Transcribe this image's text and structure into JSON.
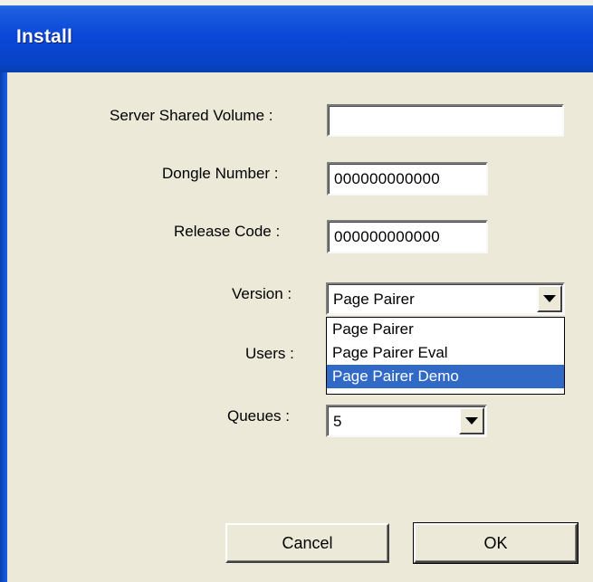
{
  "window": {
    "title": "Install"
  },
  "form": {
    "server_shared_volume": {
      "label": "Server Shared Volume :",
      "value": ""
    },
    "dongle_number": {
      "label": "Dongle Number :",
      "value": "000000000000"
    },
    "release_code": {
      "label": "Release Code :",
      "value": "000000000000"
    },
    "version": {
      "label": "Version :",
      "selected": "Page Pairer",
      "options": [
        "Page Pairer",
        "Page Pairer Eval",
        "Page Pairer Demo"
      ],
      "highlighted_option": "Page Pairer Demo"
    },
    "users": {
      "label": "Users :"
    },
    "queues": {
      "label": "Queues :",
      "selected": "5"
    }
  },
  "buttons": {
    "cancel": "Cancel",
    "ok": "OK"
  },
  "icons": {
    "dropdown_arrow": "chevron-down-icon"
  },
  "colors": {
    "titlebar": "#0a47d8",
    "dialog_bg": "#ece9d8",
    "selection": "#3169c6"
  }
}
